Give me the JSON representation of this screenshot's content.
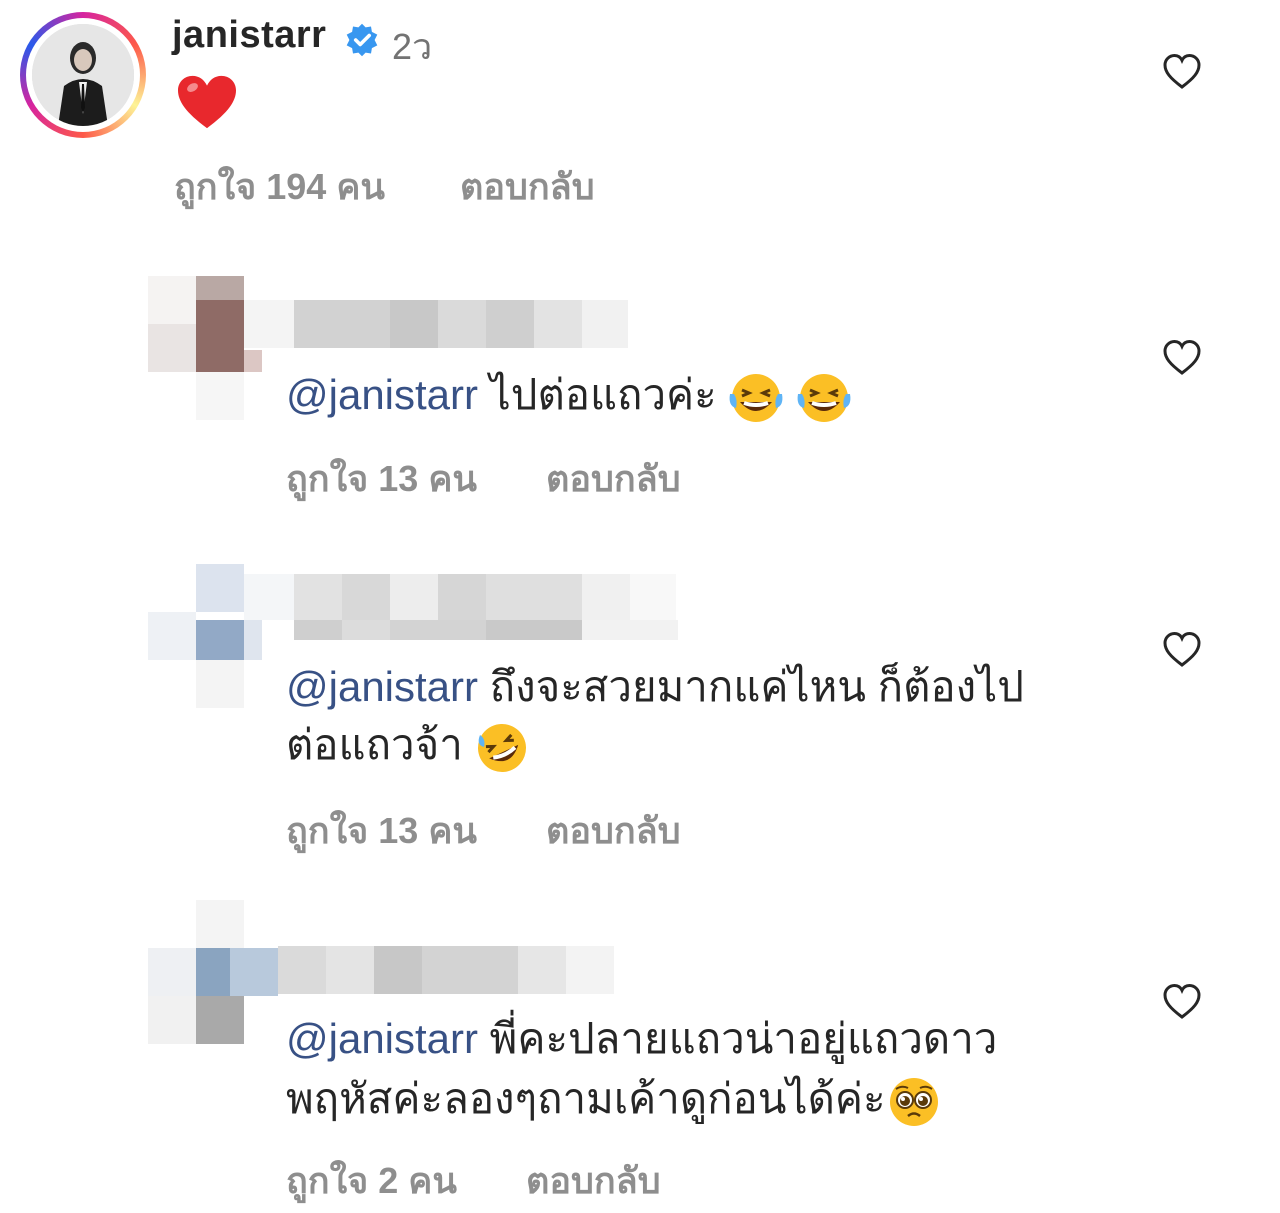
{
  "main_comment": {
    "username": "janistarr",
    "time": "2ว",
    "likes": "ถูกใจ 194 คน",
    "reply": "ตอบกลับ"
  },
  "replies": [
    {
      "mention": "@janistarr",
      "text": " ไปต่อแถวค่ะ",
      "likes": "ถูกใจ 13 คน",
      "reply": "ตอบกลับ"
    },
    {
      "mention": "@janistarr",
      "text_line1": " ถึงจะสวยมากแค่ไหน ก็ต้องไป",
      "text_line2": "ต่อแถวจ้า ",
      "likes": "ถูกใจ 13 คน",
      "reply": "ตอบกลับ"
    },
    {
      "mention": "@janistarr",
      "text_line1": " พี่คะปลายแถวน่าอยู่แถวดาว",
      "text_line2": "พฤหัสค่ะลองๆถามเค้าดูก่อนได้ค่ะ",
      "likes": "ถูกใจ 2 คน",
      "reply": "ตอบกลับ"
    }
  ],
  "colors": {
    "mention": "#385185",
    "meta": "#8e8e8e",
    "text": "#262626",
    "verified": "#3897f0"
  },
  "icons": [
    "verified-badge-icon",
    "heart-emoji-icon",
    "like-heart-icon",
    "laughing-emoji-icon",
    "rofl-emoji-icon",
    "pleading-emoji-icon"
  ]
}
